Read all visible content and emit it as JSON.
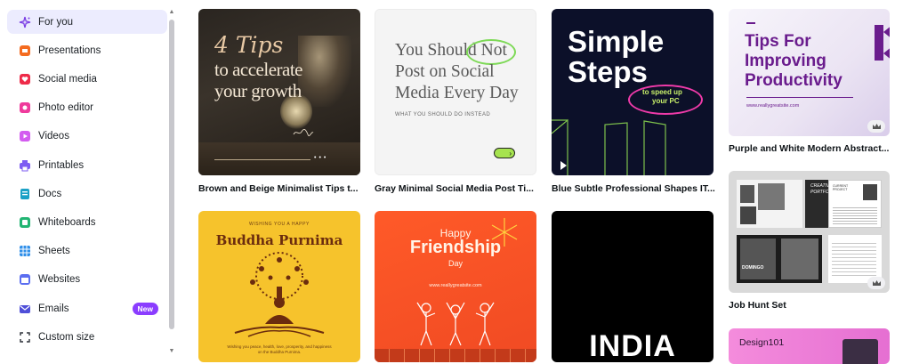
{
  "sidebar": {
    "items": [
      {
        "label": "For you",
        "icon": "sparkle-icon",
        "color": "#7b3fe4",
        "active": true
      },
      {
        "label": "Presentations",
        "icon": "presentation-icon",
        "color": "#f46b1f"
      },
      {
        "label": "Social media",
        "icon": "heart-icon",
        "color": "#ee2b49"
      },
      {
        "label": "Photo editor",
        "icon": "camera-icon",
        "color": "#ef3a9c"
      },
      {
        "label": "Videos",
        "icon": "video-icon",
        "color": "#d35cf0"
      },
      {
        "label": "Printables",
        "icon": "printer-icon",
        "color": "#7d5cf2"
      },
      {
        "label": "Docs",
        "icon": "doc-icon",
        "color": "#1ba1c6"
      },
      {
        "label": "Whiteboards",
        "icon": "whiteboard-icon",
        "color": "#22b573"
      },
      {
        "label": "Sheets",
        "icon": "sheet-icon",
        "color": "#2f8fe9"
      },
      {
        "label": "Websites",
        "icon": "website-icon",
        "color": "#5b6ef0"
      },
      {
        "label": "Emails",
        "icon": "email-icon",
        "color": "#4f4fd8",
        "badge": "New"
      },
      {
        "label": "Custom size",
        "icon": "resize-icon",
        "color": "#2a2f36"
      }
    ]
  },
  "templates": {
    "card1": {
      "caption": "Brown and Beige Minimalist Tips t...",
      "line1": "4 Tips",
      "line2": "to accelerate",
      "line3": "your growth",
      "signature": "Signature"
    },
    "card2": {
      "caption": "Gray Minimal Social Media Post Ti...",
      "line1": "You Should Not",
      "line2": "Post on Social",
      "line3": "Media Every Day",
      "sub": "WHAT YOU SHOULD DO INSTEAD"
    },
    "card3": {
      "caption": "Blue Subtle Professional Shapes IT...",
      "line1": "Simple",
      "line2": "Steps",
      "sub1": "to speed up",
      "sub2": "your PC"
    },
    "card4": {
      "caption": "Purple and White Modern Abstract...",
      "line1": "Tips For",
      "line2": "Improving",
      "line3": "Productivity",
      "url": "www.reallygreatsite.com"
    },
    "card5": {
      "top": "WISHING YOU A HAPPY",
      "title": "Buddha Purnima",
      "footer": "Wishing you peace, health, love, prosperity, and happiness on the Buddha Purnima."
    },
    "card6": {
      "line1": "Happy",
      "line2": "Friendship",
      "line3": "Day",
      "url": "www.reallygreatsite.com"
    },
    "card7": {
      "title": "INDIA"
    },
    "card8": {
      "caption": "Job Hunt Set",
      "head1": "CREATIVE",
      "head2": "PORTFOLIO",
      "domingo": "DOMINGO",
      "side": "CURRENT PROJECT"
    },
    "card9": {
      "title": "Design101"
    }
  }
}
